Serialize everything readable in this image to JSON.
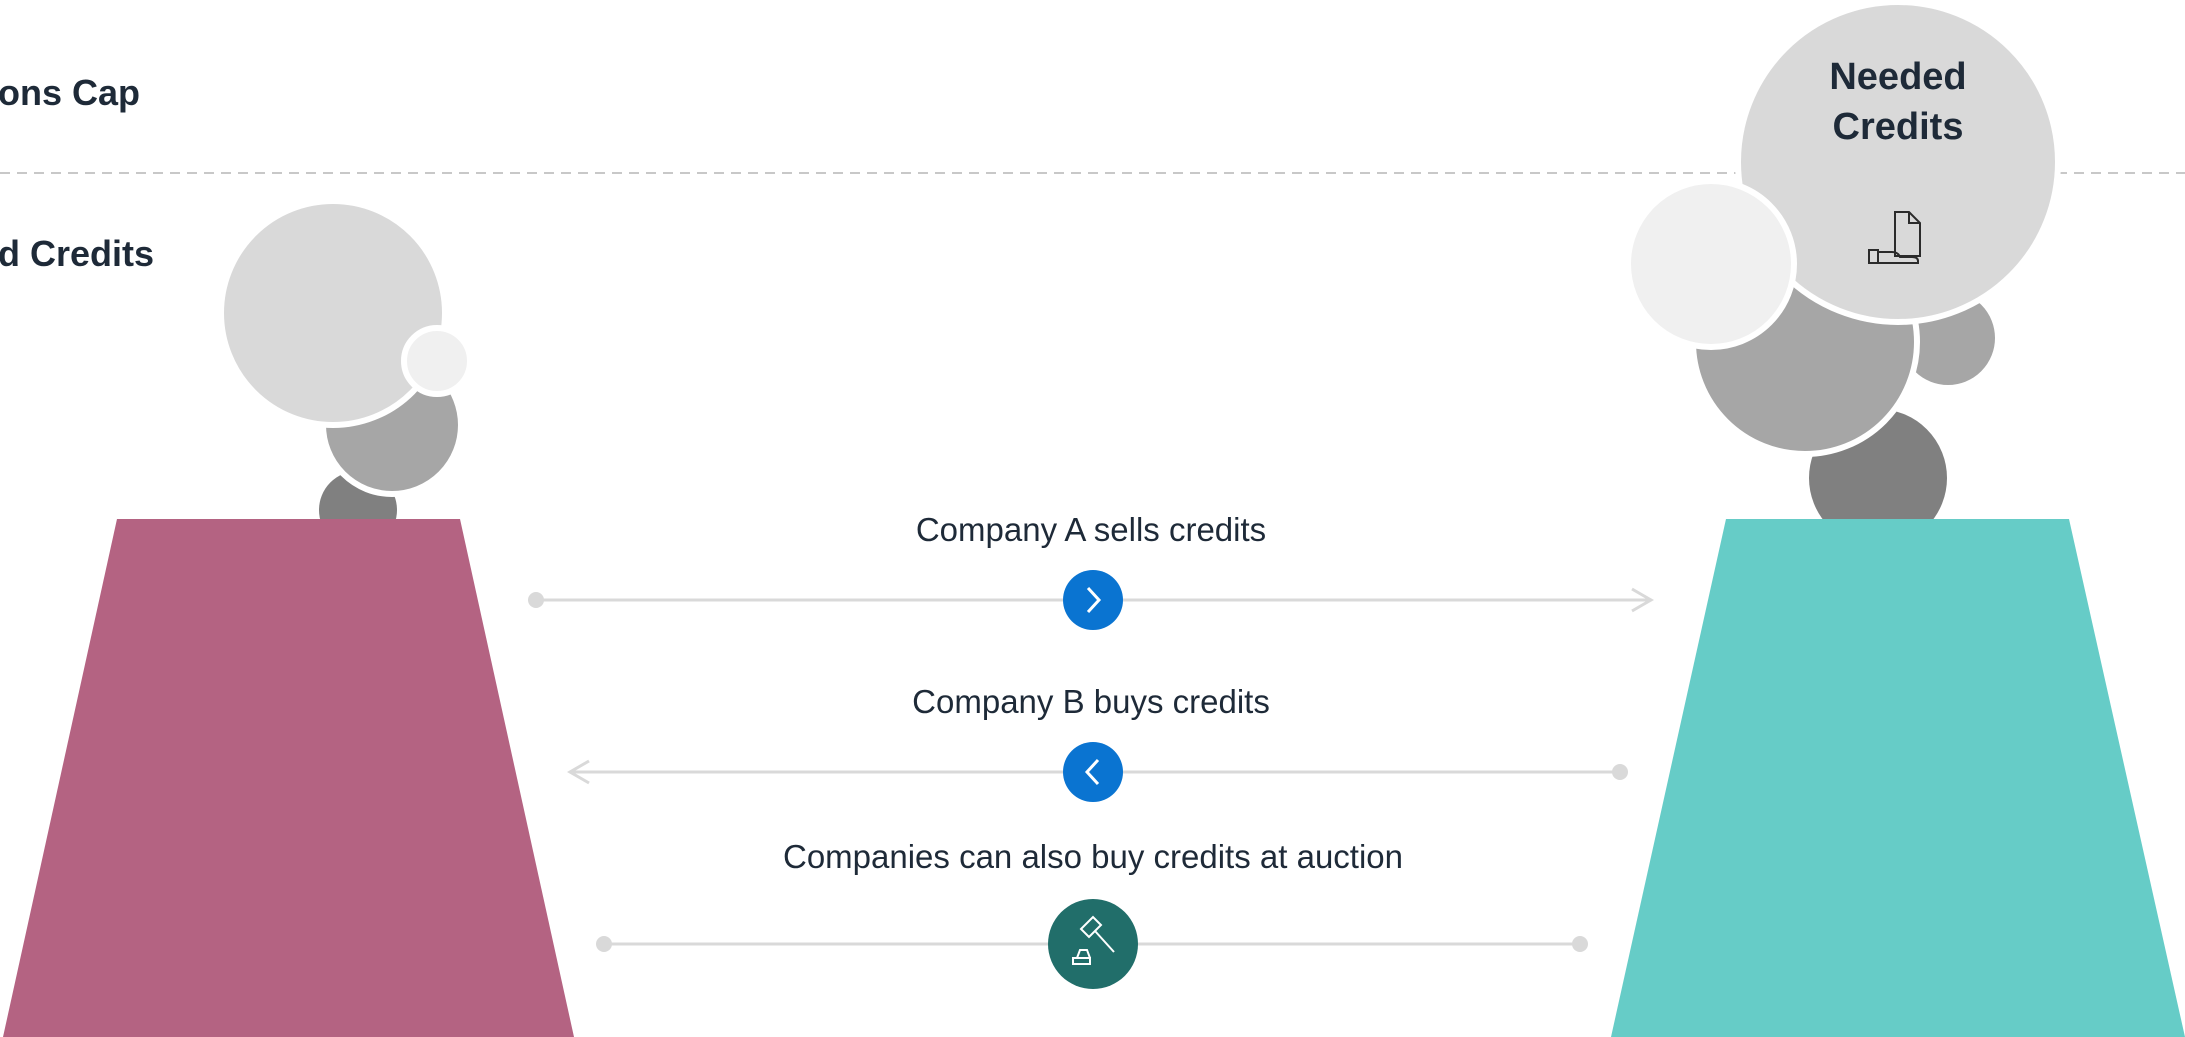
{
  "labels": {
    "cap_line": "ons Cap",
    "credits_line": "d Credits",
    "needed_credits_line1": "Needed",
    "needed_credits_line2": "Credits"
  },
  "flows": [
    {
      "text": "Company A sells credits",
      "icon": "chevron-right-icon",
      "direction": "right"
    },
    {
      "text": "Company B buys credits",
      "icon": "chevron-left-icon",
      "direction": "left"
    },
    {
      "text": "Companies can also buy credits at auction",
      "icon": "gavel-icon",
      "direction": "none"
    }
  ],
  "colors": {
    "company_a": "#b46382",
    "company_b": "#66ccc7",
    "arrow_icon_bg": "#0a74d1",
    "auction_icon_bg": "#216e6a",
    "bubble_light": "#d9d9d9",
    "bubble_lighter": "#f0f0f0",
    "bubble_mid": "#a6a6a6",
    "bubble_dark": "#808080",
    "line": "#d9d9d9"
  }
}
